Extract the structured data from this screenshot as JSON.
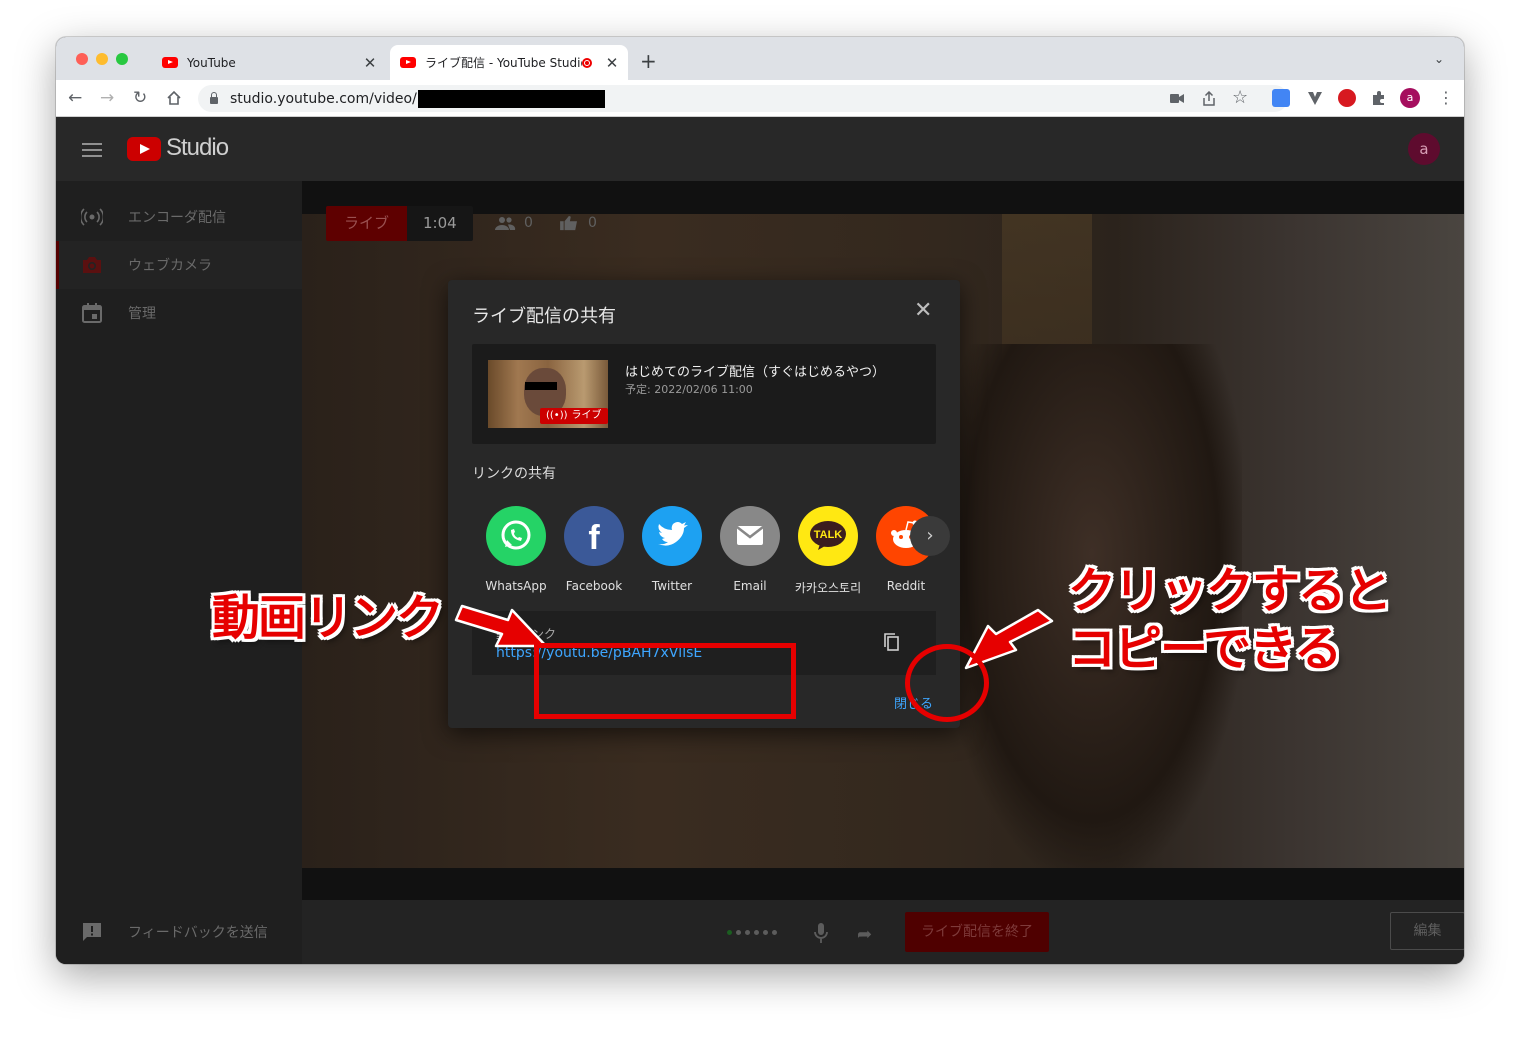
{
  "browser": {
    "tabs": [
      {
        "title": "YouTube",
        "close": "✕"
      },
      {
        "title": "ライブ配信 - YouTube Studio",
        "close": "✕"
      }
    ],
    "new_tab": "+",
    "tab_menu": "⌄",
    "url": "studio.youtube.com/video/",
    "profile_initial": "a"
  },
  "studio": {
    "logo_text": "Studio",
    "user_initial": "a",
    "sidebar": [
      {
        "label": "エンコーダ配信",
        "icon": "broadcast-icon"
      },
      {
        "label": "ウェブカメラ",
        "icon": "camera-icon"
      },
      {
        "label": "管理",
        "icon": "calendar-icon"
      }
    ],
    "feedback_label": "フィードバックを送信",
    "live_label": "ライブ",
    "timer": "1:04",
    "viewers": "0",
    "likes": "0",
    "end_stream_label": "ライブ配信を終了",
    "edit_label": "編集"
  },
  "dialog": {
    "title": "ライブ配信の共有",
    "close_icon": "✕",
    "video_title": "はじめてのライブ配信（すぐはじめるやつ）",
    "scheduled": "予定: 2022/02/06 11:00",
    "thumb_badge": "ライブ",
    "share_link_label": "リンクの共有",
    "share_targets": [
      {
        "name": "WhatsApp",
        "color": "#25d366"
      },
      {
        "name": "Facebook",
        "color": "#3b5998"
      },
      {
        "name": "Twitter",
        "color": "#1da1f2"
      },
      {
        "name": "Email",
        "color": "#888888"
      },
      {
        "name": "카카오스토리",
        "color": "#ffe812"
      },
      {
        "name": "Reddit",
        "color": "#ff4500"
      }
    ],
    "next_arrow": "›",
    "video_link_label": "動画リンク",
    "video_link_url": "https://youtu.be/pBAH7xVllsE",
    "close_label": "閉じる"
  },
  "annotations": {
    "left_text": "動画リンク",
    "right_text_line1": "クリックすると",
    "right_text_line2": "コピーできる",
    "color": "#e60000"
  }
}
